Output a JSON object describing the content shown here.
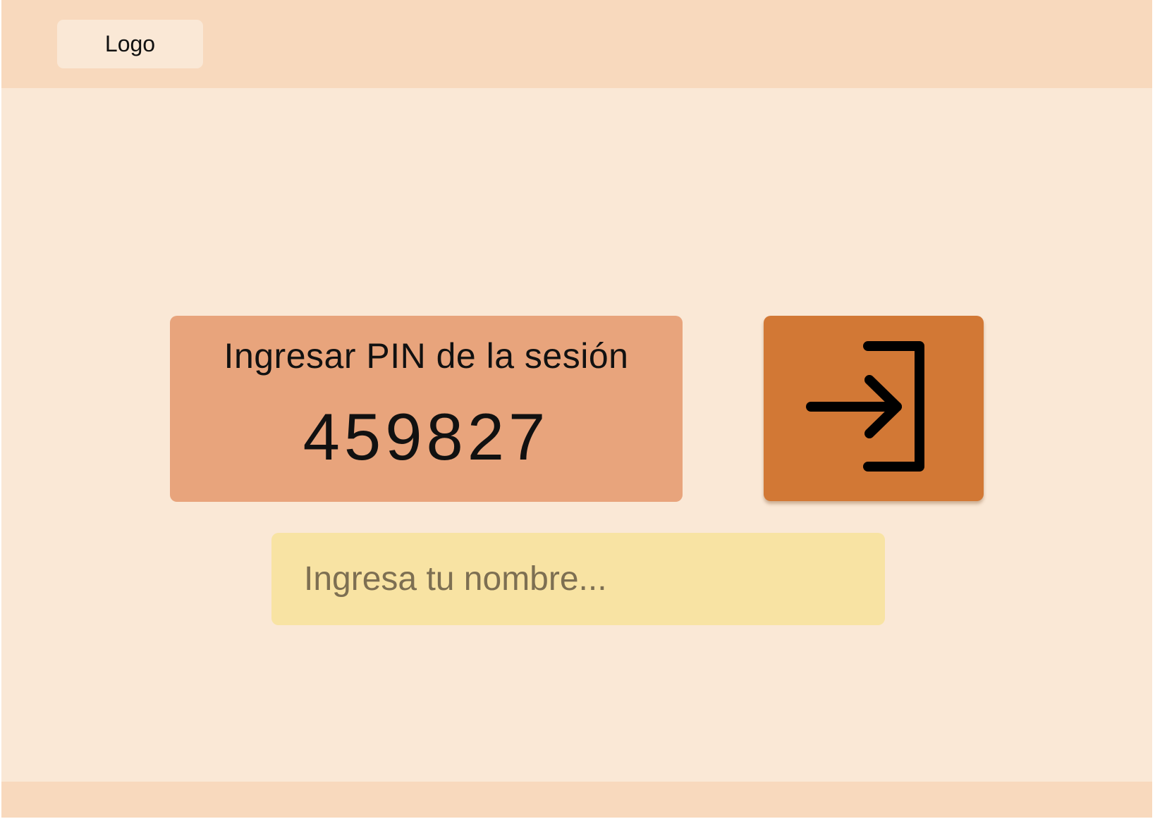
{
  "header": {
    "logo_label": "Logo"
  },
  "session": {
    "pin_label": "Ingresar PIN de la sesión",
    "pin_value": "459827"
  },
  "enter_button": {
    "icon": "login-arrow-icon"
  },
  "name_field": {
    "value": "",
    "placeholder": "Ingresa tu nombre..."
  },
  "colors": {
    "page_background": "#fae8d6",
    "header_footer": "#f8d9bd",
    "pin_card": "#e8a47c",
    "enter_button": "#d27835",
    "name_field": "#f8e3a3"
  }
}
